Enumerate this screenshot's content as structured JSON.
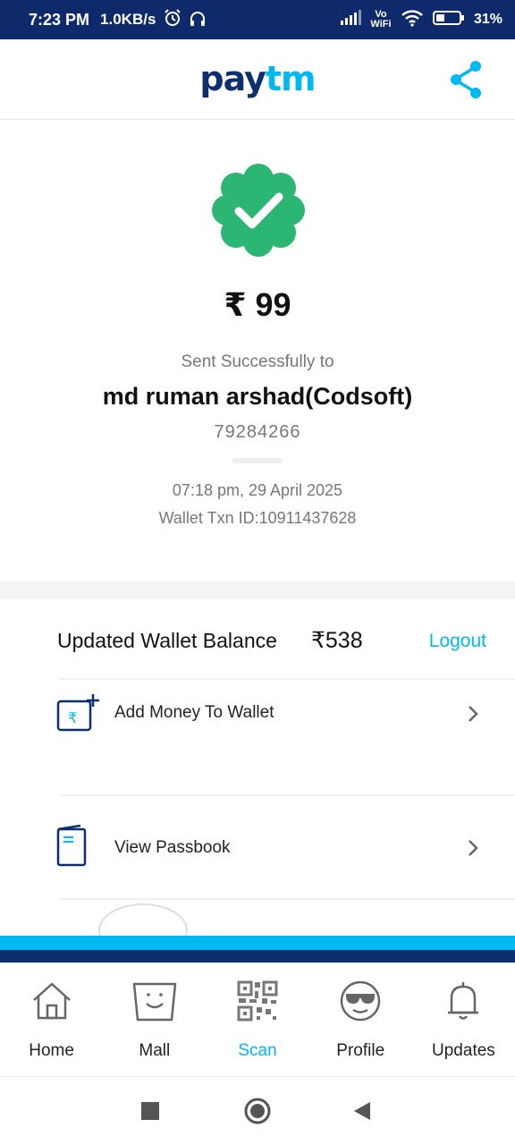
{
  "status_bar": {
    "time": "7:23 PM",
    "speed": "1.0KB/s",
    "battery": "31%",
    "network": "Vo WiFi"
  },
  "header": {
    "logo_pay": "pay",
    "logo_tm": "tm"
  },
  "payment": {
    "amount": "₹ 99",
    "status_text": "Sent Successfully to",
    "recipient": "md ruman arshad(Codsoft)",
    "phone": "79284266",
    "datetime": "07:18 pm,  29 April 2025",
    "txn_id": "Wallet Txn ID:10911437628"
  },
  "wallet": {
    "balance_label": "Updated Wallet Balance",
    "balance_value": "₹538",
    "logout_label": "Logout",
    "items": [
      {
        "label": "Add Money To Wallet",
        "icon": "add-money-icon"
      },
      {
        "label": "View Passbook",
        "icon": "passbook-icon"
      }
    ]
  },
  "bottom_nav": {
    "items": [
      {
        "label": "Home",
        "icon": "home-icon"
      },
      {
        "label": "Mall",
        "icon": "mall-icon"
      },
      {
        "label": "Scan",
        "icon": "qr-scan-icon",
        "active": true
      },
      {
        "label": "Profile",
        "icon": "profile-icon"
      },
      {
        "label": "Updates",
        "icon": "bell-icon"
      }
    ]
  },
  "colors": {
    "brand_dark": "#0d2f6e",
    "brand_light": "#00b9f1",
    "success_green": "#2bb673",
    "status_bar": "#0e2a6a"
  }
}
